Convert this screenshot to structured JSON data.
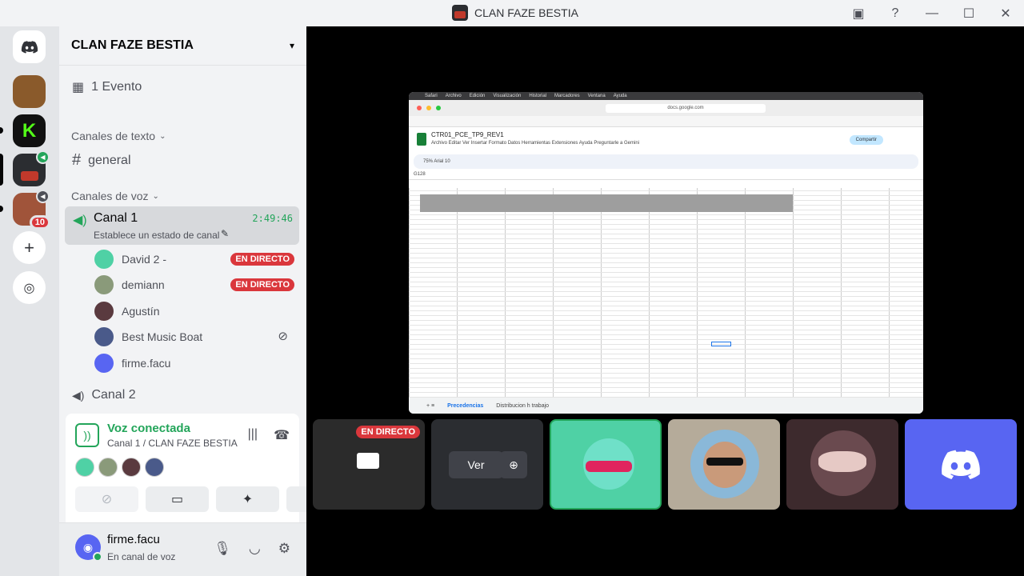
{
  "window": {
    "title": "CLAN FAZE BESTIA"
  },
  "guild": {
    "name": "CLAN FAZE BESTIA",
    "event": "1 Evento"
  },
  "text_category": "Canales de texto",
  "text_channel": "general",
  "voice_category": "Canales de voz",
  "voice_channel": {
    "name": "Canal 1",
    "timer": "2:49:46",
    "status": "Establece un estado de canal"
  },
  "members": [
    {
      "name": "David 2 -",
      "live": "EN DIRECTO"
    },
    {
      "name": "demiann",
      "live": "EN DIRECTO"
    },
    {
      "name": "Agustín"
    },
    {
      "name": "Best Music Boat"
    },
    {
      "name": "firme.facu"
    }
  ],
  "voice_channel_2": "Canal 2",
  "server_badge": "10",
  "voice_panel": {
    "title": "Voz conectada",
    "subtitle": "Canal 1 / CLAN FAZE BESTIA"
  },
  "user": {
    "name": "firme.facu",
    "status": "En canal de voz"
  },
  "stream": {
    "menu": [
      "Safari",
      "Archivo",
      "Edición",
      "Visualización",
      "Historial",
      "Marcadores",
      "Ventana",
      "Ayuda"
    ],
    "url": "docs.google.com",
    "doc_title": "CTR01_PCE_TP9_REV1",
    "doc_menu": "Archivo   Editar   Ver   Insertar   Formato   Datos   Herramientas   Extensiones   Ayuda   Preguntarle a Gemini",
    "share": "Compartir",
    "toolbar": "75%   Arial   10",
    "cell": "G128",
    "sheet_active": "Precedencias",
    "sheet_other": "Distribucion h trabajo"
  },
  "tiles": {
    "live": "EN DIRECTO",
    "watch": "Ver"
  }
}
